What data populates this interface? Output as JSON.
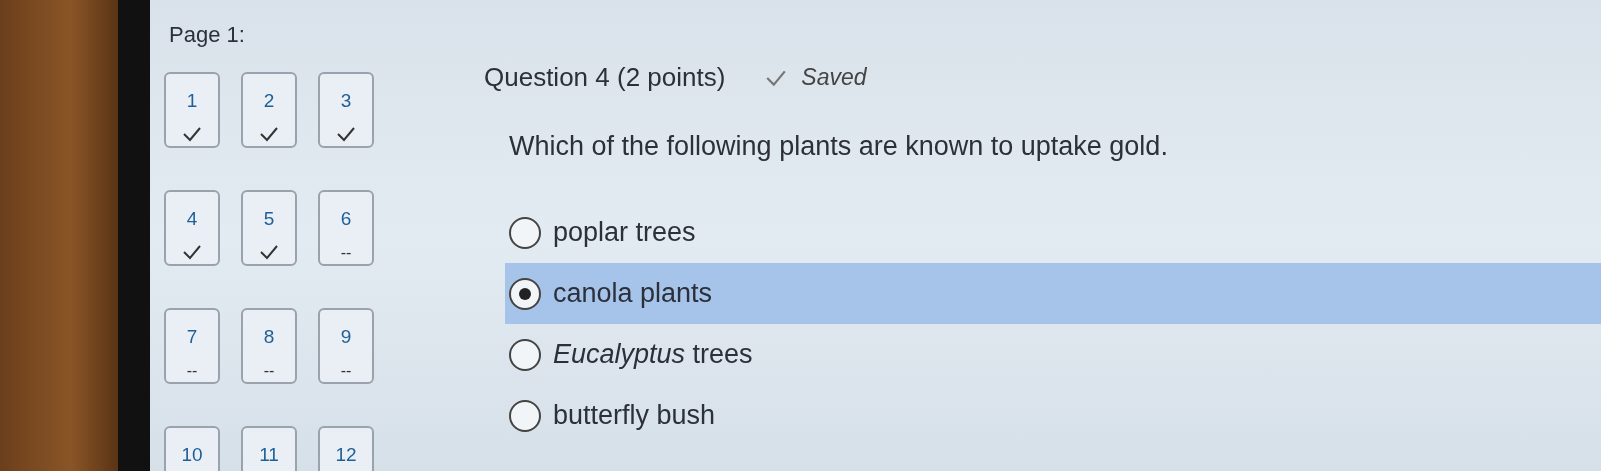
{
  "page_label": "Page 1:",
  "questions": [
    {
      "number": "1",
      "answered": true
    },
    {
      "number": "2",
      "answered": true
    },
    {
      "number": "3",
      "answered": true
    },
    {
      "number": "4",
      "answered": true
    },
    {
      "number": "5",
      "answered": true
    },
    {
      "number": "6",
      "answered": false,
      "mark": "--"
    },
    {
      "number": "7",
      "answered": false,
      "mark": "--"
    },
    {
      "number": "8",
      "answered": false,
      "mark": "--"
    },
    {
      "number": "9",
      "answered": false,
      "mark": "--"
    },
    {
      "number": "10"
    },
    {
      "number": "11"
    },
    {
      "number": "12"
    }
  ],
  "question": {
    "title": "Question 4 (2 points)",
    "saved": true,
    "saved_label": "Saved",
    "prompt": "Which of the following plants are known to uptake gold.",
    "options": [
      {
        "label": "poplar trees",
        "selected": false
      },
      {
        "label": "canola plants",
        "selected": true
      },
      {
        "label": "*Eucalyptus* trees",
        "selected": false
      },
      {
        "label": "butterfly bush",
        "selected": false
      }
    ]
  }
}
